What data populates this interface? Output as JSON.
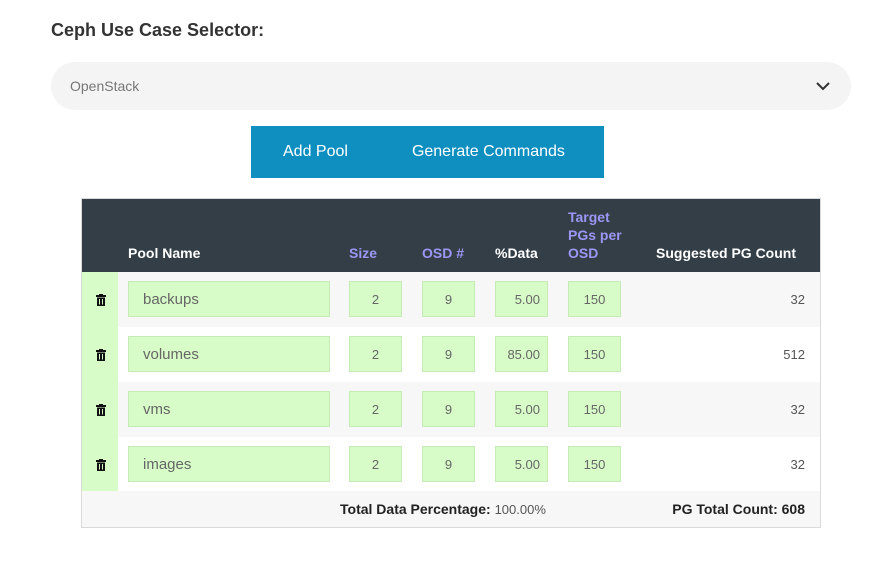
{
  "title": "Ceph Use Case Selector:",
  "selector": {
    "value": "OpenStack",
    "icon": "chevron-down-icon"
  },
  "buttons": {
    "add_pool": "Add Pool",
    "generate": "Generate Commands"
  },
  "table": {
    "headers": {
      "pool_name": "Pool Name",
      "size": "Size",
      "osd": "OSD #",
      "data": "%Data",
      "target_1": "Target",
      "target_2": "PGs per",
      "target_3": "OSD",
      "suggested": "Suggested PG Count"
    },
    "rows": [
      {
        "name": "backups",
        "size": "2",
        "osd": "9",
        "data": "5.00",
        "target": "150",
        "pg": "32"
      },
      {
        "name": "volumes",
        "size": "2",
        "osd": "9",
        "data": "85.00",
        "target": "150",
        "pg": "512"
      },
      {
        "name": "vms",
        "size": "2",
        "osd": "9",
        "data": "5.00",
        "target": "150",
        "pg": "32"
      },
      {
        "name": "images",
        "size": "2",
        "osd": "9",
        "data": "5.00",
        "target": "150",
        "pg": "32"
      }
    ],
    "footer": {
      "total_data_label": "Total Data Percentage:",
      "total_data_value": "100.00%",
      "pg_total": "PG Total Count: 608"
    }
  },
  "colors": {
    "button_bg": "#0e8fc0",
    "header_bg": "#333e46",
    "header_accent": "#9d96f5",
    "input_bg": "#d7fcc8"
  }
}
